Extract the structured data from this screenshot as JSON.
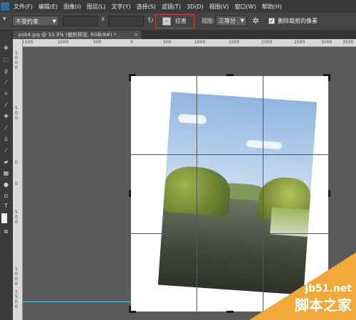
{
  "menu": {
    "items": [
      "文件(F)",
      "编辑(E)",
      "图像(I)",
      "图层(L)",
      "文字(Y)",
      "选择(S)",
      "滤镜(T)",
      "3D(D)",
      "视图(V)",
      "窗口(W)",
      "帮助(H)"
    ]
  },
  "options": {
    "ratio_value": "不受约束",
    "x_label": "x",
    "straighten_label": "拉直",
    "view_label": "视图:",
    "view_value": "三等分",
    "delete_cropped_label": "删除裁剪的像素",
    "delete_cropped_checked": true
  },
  "tab": {
    "title": "psb4.jpg @ 33.3% (裁剪预览, RGB/8#) *",
    "close": "×"
  },
  "ruler": {
    "h_labels": [
      "1500",
      "1000",
      "500",
      "0",
      "500",
      "1000",
      "1500",
      "2000",
      "2500",
      "3000",
      "3500"
    ],
    "v_labels": [
      "1",
      "0",
      "0",
      "0",
      "5",
      "0",
      "0",
      "0",
      "0",
      "5",
      "0",
      "0",
      "1",
      "0",
      "0",
      "0",
      "1",
      "5",
      "0",
      "0",
      "2",
      "0",
      "0",
      "0",
      "2",
      "5",
      "0",
      "0",
      "3",
      "0",
      "0",
      "0"
    ]
  },
  "toolbar": {
    "icons": [
      "move-icon",
      "marquee-icon",
      "lasso-icon",
      "quick-select-icon",
      "crop-icon",
      "eyedropper-icon",
      "healing-icon",
      "brush-icon",
      "stamp-icon",
      "history-brush-icon",
      "eraser-icon",
      "gradient-icon",
      "blur-icon",
      "dodge-icon",
      "pen-icon",
      "type-icon",
      "path-select-icon",
      "shape-icon",
      "hand-icon",
      "zoom-icon"
    ]
  },
  "watermark": {
    "top": "jb51.net",
    "bottom": "脚本之家"
  },
  "colors": {
    "accent_red": "#c73c3c",
    "guide_cyan": "#4ed4e6",
    "watermark_orange": "#f0a83a"
  }
}
